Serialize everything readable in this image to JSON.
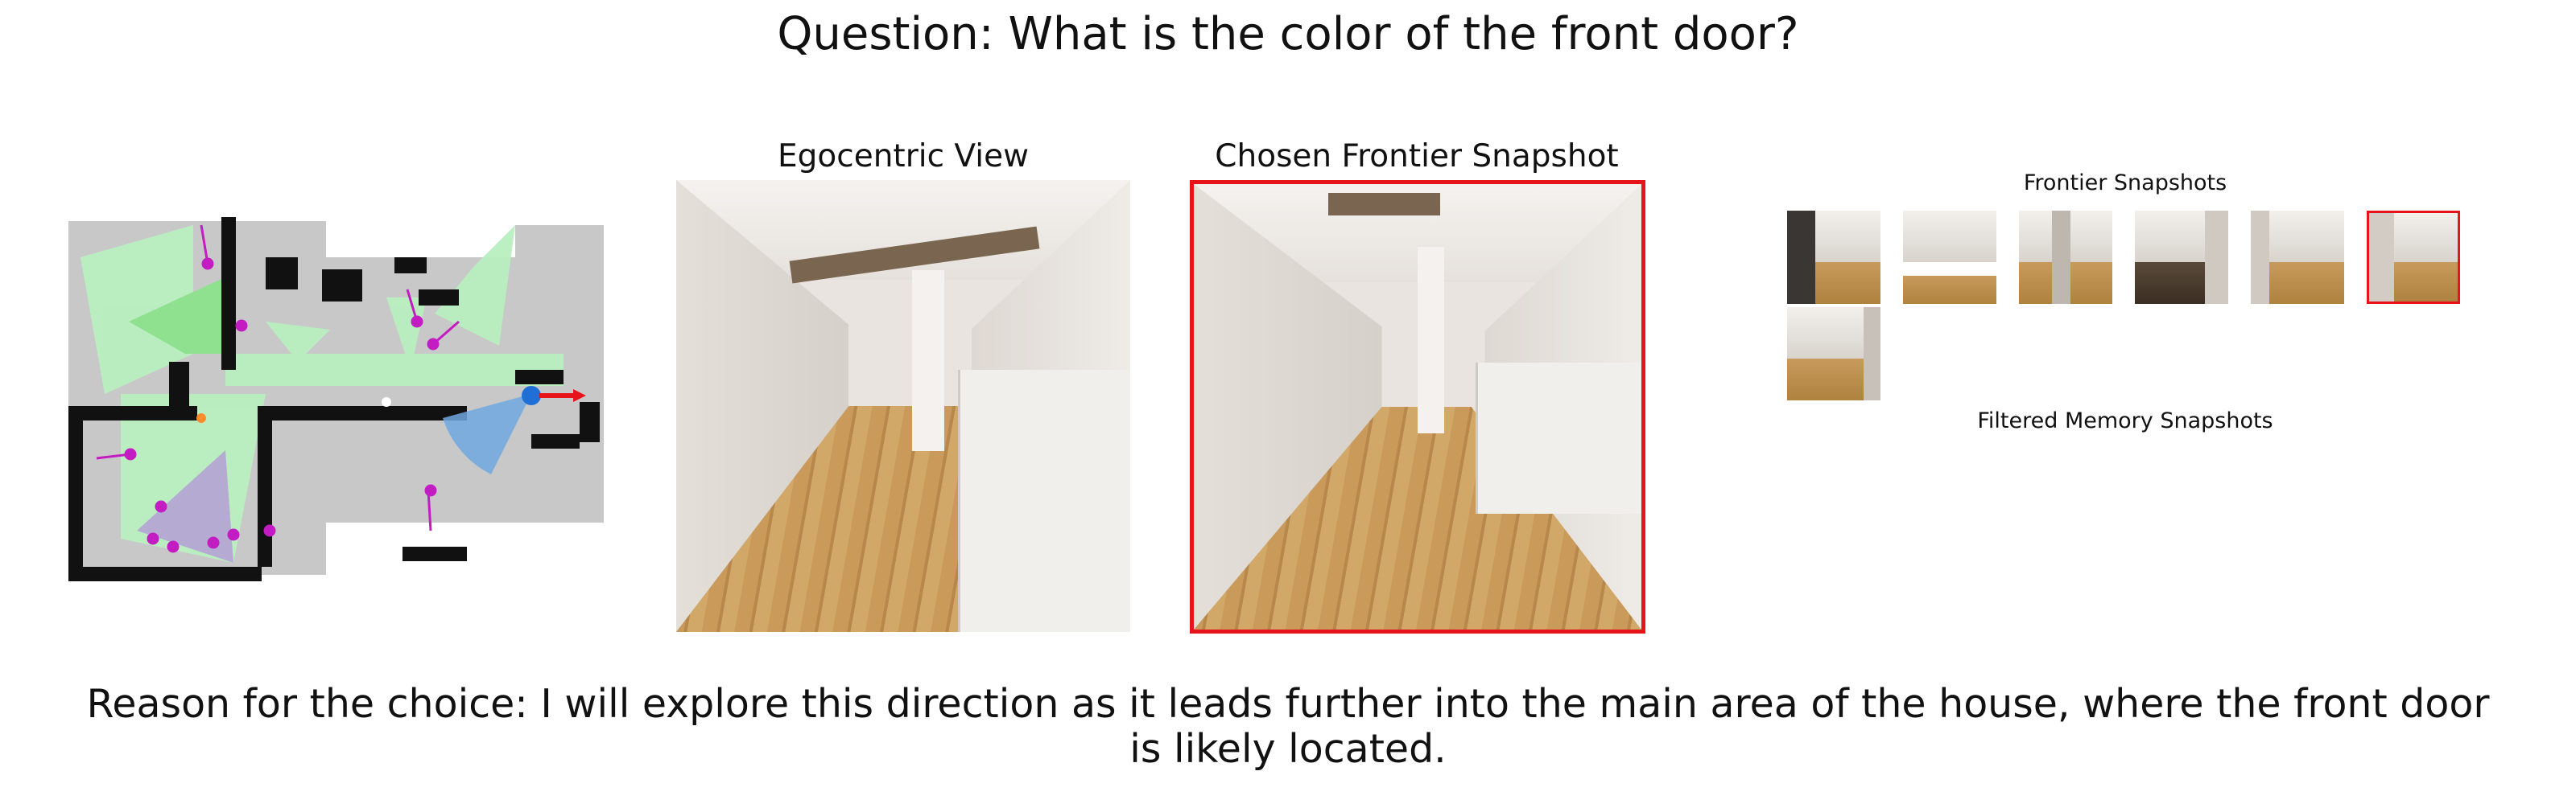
{
  "question": "Question: What is the color of the front door?",
  "panels": {
    "egocentric_title": "Egocentric View",
    "chosen_title": "Chosen Frontier Snapshot",
    "frontier_title": "Frontier Snapshots",
    "memory_title": "Filtered Memory Snapshots"
  },
  "reason": "Reason for the choice: I will explore this direction as it leads further into the main area of the house, where the front door is likely located.",
  "colors": {
    "chosen_border": "#e8141c",
    "map_free": "#c8c8c8",
    "map_wall": "#000000",
    "map_explored": "#b9f0c0",
    "agent": "#1f6fd6",
    "frontier_marker": "#c21cc2"
  },
  "icons": {
    "agent_marker": "agent-position-icon",
    "frontier_markers": "frontier-point-icon",
    "direction_arrow": "direction-arrow-icon"
  },
  "frontier_snapshots": [
    {
      "selected": false
    },
    {
      "selected": false
    },
    {
      "selected": false
    },
    {
      "selected": false
    },
    {
      "selected": false
    },
    {
      "selected": true
    },
    {
      "selected": false
    }
  ]
}
